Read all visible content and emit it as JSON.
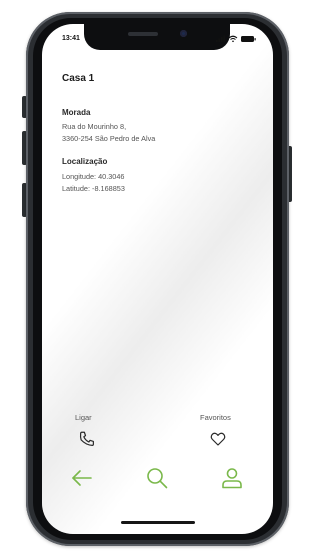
{
  "status_bar": {
    "time": "13:41"
  },
  "page": {
    "title": "Casa 1"
  },
  "morada": {
    "label": "Morada",
    "line1": "Rua do Mourinho 8,",
    "line2": "3360-254 São Pedro de Alva"
  },
  "localizacao": {
    "label": "Localização",
    "longitude": "Longitude: 40.3046",
    "latitude": "Latitude: -8.168853"
  },
  "actions": {
    "call_label": "Ligar",
    "favorites_label": "Favoritos"
  },
  "icons": {
    "call": "phone-icon",
    "favorite": "heart-icon",
    "back": "arrow-left-icon",
    "search": "search-icon",
    "profile": "user-icon"
  },
  "colors": {
    "accent": "#7ab84a"
  }
}
